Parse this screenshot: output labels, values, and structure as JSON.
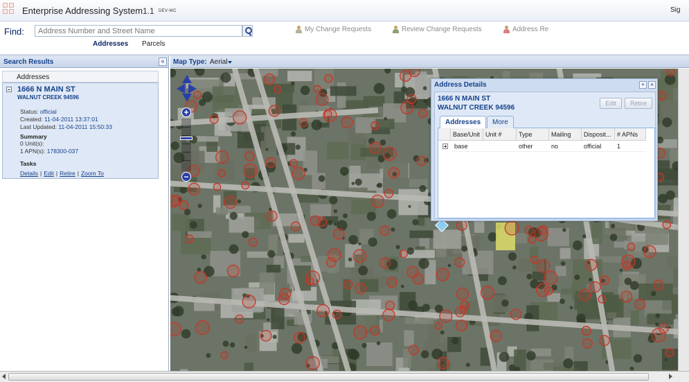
{
  "app": {
    "title": "Enterprise Addressing System",
    "version": "1.1",
    "env": "DEV-WC",
    "signin_label": "Sig"
  },
  "find": {
    "label": "Find:",
    "placeholder": "Address Number and Street Name",
    "tabs": [
      {
        "label": "Addresses",
        "active": true
      },
      {
        "label": "Parcels",
        "active": false
      }
    ],
    "links": [
      {
        "label": "My Change Requests",
        "icon": "person-icon"
      },
      {
        "label": "Review Change Requests",
        "icon": "person-icon"
      },
      {
        "label": "Address Re",
        "icon": "person-icon"
      }
    ]
  },
  "search_results": {
    "title": "Search Results",
    "column_header": "Addresses",
    "result": {
      "street": "1666 N MAIN ST",
      "city": "WALNUT CREEK 94596",
      "status_label": "Status:",
      "status_value": "official",
      "created_label": "Created:",
      "created_value": "11-04-2011 13:37:01",
      "updated_label": "Last Updated:",
      "updated_value": "11-04-2011 15:50:33",
      "summary_title": "Summary",
      "units": "0 Unit(s):",
      "apns_label": "1 APN(s):",
      "apns_value": "178300-037",
      "tasks_title": "Tasks",
      "tasks": [
        "Details",
        "Edit",
        "Retire",
        "Zoom To"
      ]
    }
  },
  "map": {
    "type_label": "Map Type:",
    "type_value": "Aerial",
    "marker_color": "#c0392b"
  },
  "address_details": {
    "title": "Address Details",
    "street": "1666 N MAIN ST",
    "city": "WALNUT CREEK 94596",
    "edit_label": "Edit",
    "retire_label": "Retire",
    "tabs": [
      {
        "label": "Addresses",
        "active": true
      },
      {
        "label": "More",
        "active": false
      }
    ],
    "columns": [
      "Base/Unit",
      "Unit #",
      "Type",
      "Mailing",
      "Disposit...",
      "# APNs"
    ],
    "rows": [
      [
        "base",
        "",
        "other",
        "no",
        "official",
        "1"
      ]
    ]
  }
}
